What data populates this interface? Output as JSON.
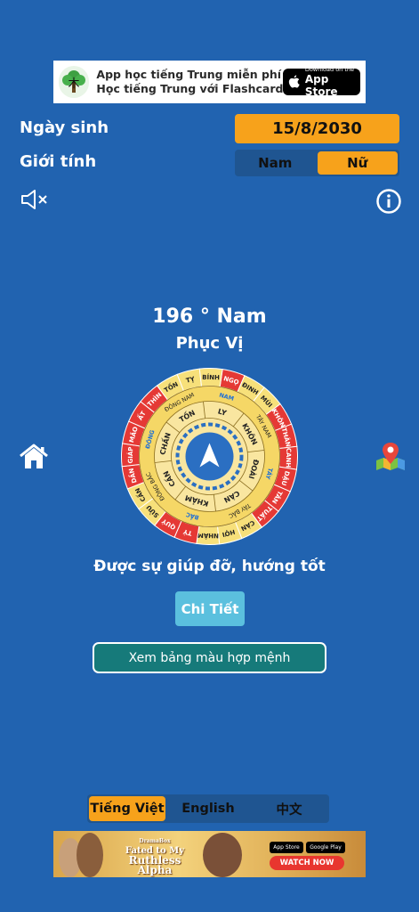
{
  "ad_top": {
    "line1": "App học tiếng Trung miễn phí",
    "line2": "Học tiếng Trung với Flashcard",
    "badge_small": "Download on the",
    "badge_big": "App Store",
    "logo_char": "木"
  },
  "form": {
    "birthday_label": "Ngày sinh",
    "birthday_value": "15/8/2030",
    "gender_label": "Giới tính",
    "gender_options": [
      "Nam",
      "Nữ"
    ],
    "gender_selected": "Nữ"
  },
  "result": {
    "degree": "196 ° Nam",
    "direction_name": "Phục Vị",
    "description": "Được sự giúp đỡ, hướng tốt",
    "detail_button": "Chi Tiết",
    "color_table_button": "Xem bảng màu hợp mệnh"
  },
  "compass": {
    "outer_ring": [
      "NGỌ",
      "ĐINH",
      "MÙI",
      "KHÔN",
      "THÂN",
      "CANH",
      "DẬU",
      "TÂN",
      "TUẤT",
      "CÀN",
      "HỢI",
      "NHÂM",
      "TÝ",
      "QUÝ",
      "SỬU",
      "CẤN",
      "DẦN",
      "GIÁP",
      "MÃO",
      "ẤT",
      "THÌN",
      "TỐN",
      "TỴ",
      "BÍNH"
    ],
    "middle_ring": [
      "NAM",
      "TÂY NAM",
      "TÂY",
      "TÂY BẮC",
      "BẮC",
      "ĐÔNG BẮC",
      "ĐÔNG",
      "ĐÔNG NAM"
    ],
    "inner_ring": [
      "LY",
      "KHÔN",
      "ĐOÀI",
      "CÀN",
      "KHẢM",
      "CẤN",
      "CHẤN",
      "TỐN"
    ],
    "colors": {
      "outer_red": "#e53935",
      "outer_yellow": "#f7e07a",
      "middle_yellow": "#f5d766",
      "inner_yellow": "#f9e6a0",
      "text_dark": "#222222",
      "text_blue": "#1e6fd6",
      "hub": "#2b6fc2"
    }
  },
  "languages": {
    "items": [
      "Tiếng Việt",
      "English",
      "中文"
    ],
    "selected": "Tiếng Việt"
  },
  "ad_bottom": {
    "brand": "DramaBox",
    "title_line1": "Fated to My",
    "title_line2": "Ruthless",
    "title_line3": "Alpha",
    "app_store": "App Store",
    "google_play": "Google Play",
    "cta": "WATCH NOW"
  },
  "icons": {
    "mute": "speaker-mute-icon",
    "info": "info-icon",
    "home": "home-icon",
    "map": "map-pin-icon",
    "compass_arrow": "navigation-arrow-icon"
  }
}
